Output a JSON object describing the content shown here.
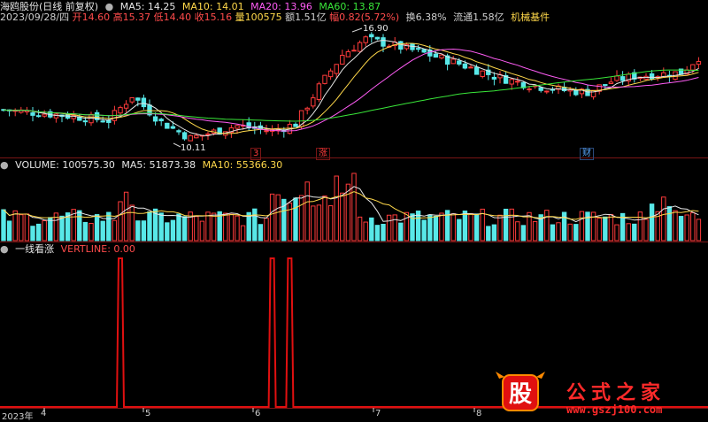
{
  "header": {
    "title": "海鸥股份(日线 前复权)",
    "ma": [
      {
        "label": "MA5: 14.25",
        "color": "#e6e6e6"
      },
      {
        "label": "MA10: 14.01",
        "color": "#ffd84a"
      },
      {
        "label": "MA20: 13.96",
        "color": "#ff5cf5"
      },
      {
        "label": "MA60: 13.87",
        "color": "#39e639"
      }
    ]
  },
  "quote": {
    "date": "2023/09/28/四",
    "open": "开14.60",
    "high": "高15.37",
    "low": "低14.40",
    "close": "收15.16",
    "volume": "量100575",
    "amount": "额1.51亿",
    "change": "幅0.82(5.72%)",
    "turnover": "换6.38%",
    "float": "流通1.58亿",
    "sector": "机械基件"
  },
  "price_panel": {
    "high_label": "16.90",
    "low_label": "10.11",
    "markers": [
      {
        "text": "3",
        "color": "#ff3b3b"
      },
      {
        "text": "涨",
        "color": "#ff3b3b"
      },
      {
        "text": "财",
        "color": "#58a8ff"
      }
    ]
  },
  "volume_panel": {
    "label": "VOLUME: 100575.30",
    "ma5": "MA5: 51873.38",
    "ma10": "MA10: 55366.30"
  },
  "indicator_panel": {
    "name": "一线看涨",
    "vertline": "VERTLINE: 0.00"
  },
  "x_axis": {
    "labels": [
      "2023年",
      "4",
      "5",
      "6",
      "7",
      "8"
    ]
  },
  "watermark": {
    "logo_char": "股",
    "text": "公式之家",
    "url": "www.gszj100.com"
  },
  "chart_data": {
    "type": "candlestick",
    "bars": 120,
    "price_range": [
      10.11,
      16.9
    ],
    "indicator_spikes_at_bar": [
      20,
      46,
      49
    ]
  }
}
